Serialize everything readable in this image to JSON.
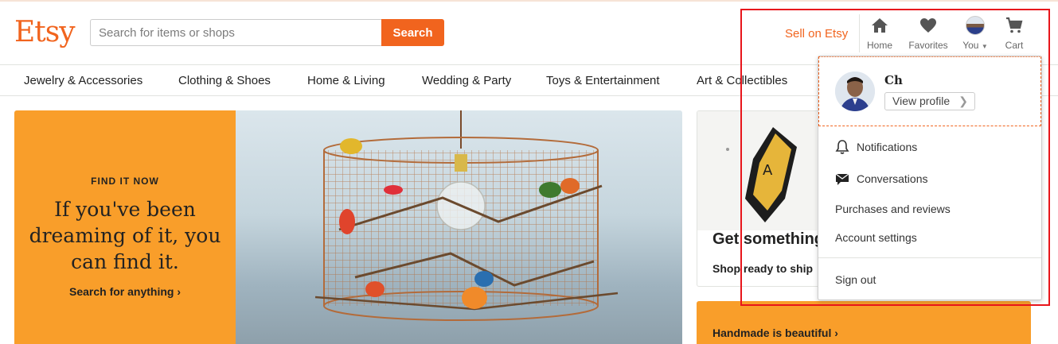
{
  "header": {
    "logo": "Etsy",
    "search_placeholder": "Search for items or shops",
    "search_button": "Search",
    "sell_link": "Sell on Etsy",
    "nav": {
      "home": "Home",
      "favorites": "Favorites",
      "you": "You",
      "cart": "Cart"
    }
  },
  "categories": [
    "Jewelry & Accessories",
    "Clothing & Shoes",
    "Home & Living",
    "Wedding & Party",
    "Toys & Entertainment",
    "Art & Collectibles"
  ],
  "hero": {
    "kicker": "FIND IT NOW",
    "title": "If you've been dreaming of it, you can find it.",
    "link": "Search for anything ›"
  },
  "cards": {
    "card1_title": "Get something",
    "card1_link": "Shop ready to ship",
    "card2_link": "Handmade is beautiful ›"
  },
  "dropdown": {
    "name": "Ch",
    "view_profile": "View profile",
    "items": {
      "notifications": "Notifications",
      "conversations": "Conversations",
      "purchases": "Purchases and reviews",
      "account": "Account settings",
      "signout": "Sign out"
    }
  },
  "colors": {
    "brand": "#f1641e",
    "hero_orange": "#f99e2a",
    "annotation": "#e8151b"
  }
}
